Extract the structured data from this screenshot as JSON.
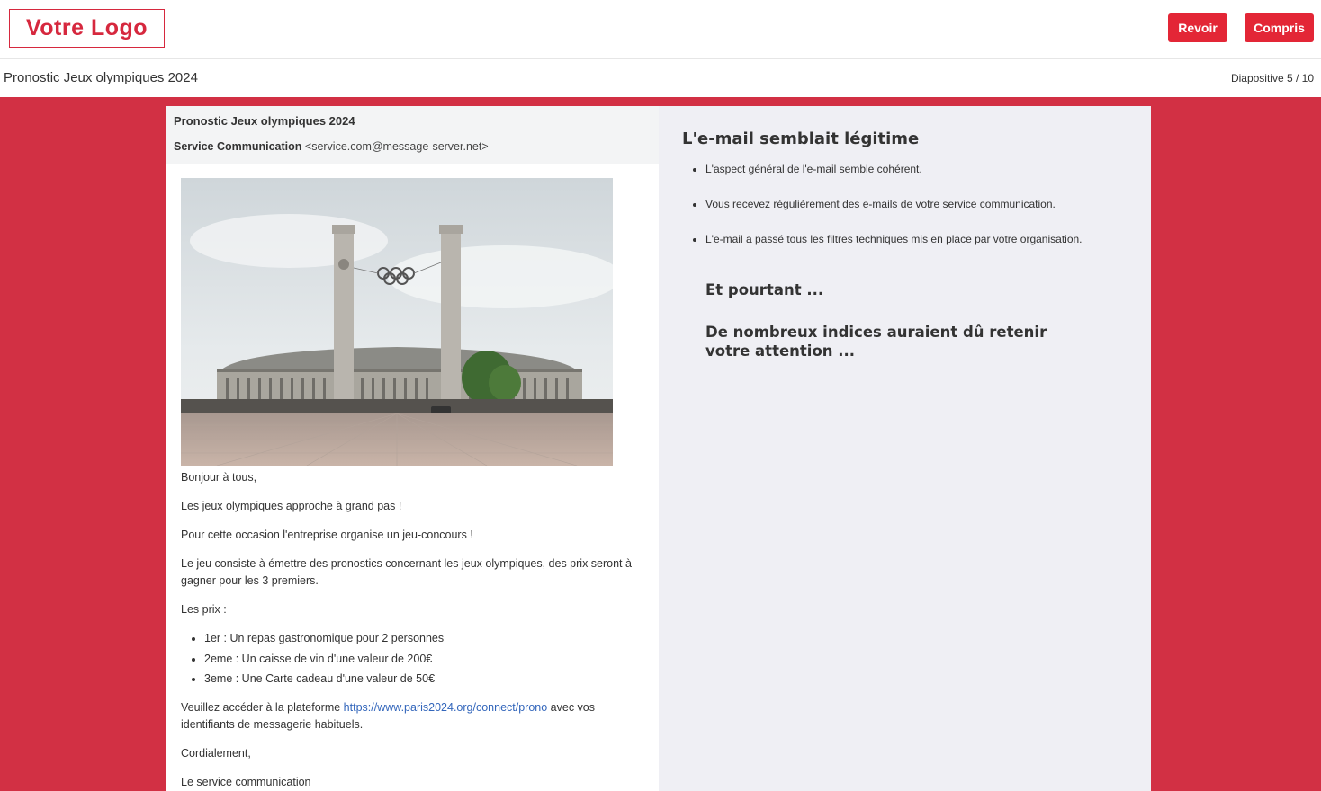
{
  "header": {
    "logo_text": "Votre Logo",
    "buttons": {
      "revoir": "Revoir",
      "compris": "Compris"
    },
    "accent_color": "#e32636"
  },
  "titlebar": {
    "course_title": "Pronostic Jeux olympiques 2024",
    "slide_counter": "Diapositive 5 / 10"
  },
  "email": {
    "subject": "Pronostic Jeux olympiques 2024",
    "sender_name": "Service Communication",
    "sender_address": "<service.com@message-server.net>",
    "image_icon": "olympic-stadium-photo",
    "greeting": "Bonjour à tous,",
    "paragraphs": [
      "Les jeux olympiques approche à grand pas !",
      "Pour cette occasion l'entreprise organise un jeu-concours !",
      "Le jeu consiste à émettre des pronostics concernant les jeux olympiques, des prix seront à gagner pour les 3 premiers.",
      "Les prix :"
    ],
    "prizes": [
      "1er : Un repas gastronomique pour 2 personnes",
      "2eme : Un caisse de vin d'une valeur de 200€",
      "3eme : Une Carte cadeau d'une valeur de 50€"
    ],
    "cta_before": "Veuillez accéder à la plateforme ",
    "cta_link": "https://www.paris2024.org/connect/prono",
    "cta_after": " avec vos identifiants de messagerie habituels.",
    "closing": "Cordialement,",
    "signature": "Le service communication"
  },
  "panel": {
    "title": "L'e-mail semblait légitime",
    "points": [
      "L'aspect général de l'e-mail semble cohérent.",
      "Vous recevez régulièrement des e-mails de votre service communication.",
      "L'e-mail a passé tous les filtres techniques mis en place par votre organisation."
    ],
    "sub1": "Et pourtant ...",
    "sub2": "De nombreux indices auraient dû retenir votre attention ..."
  }
}
